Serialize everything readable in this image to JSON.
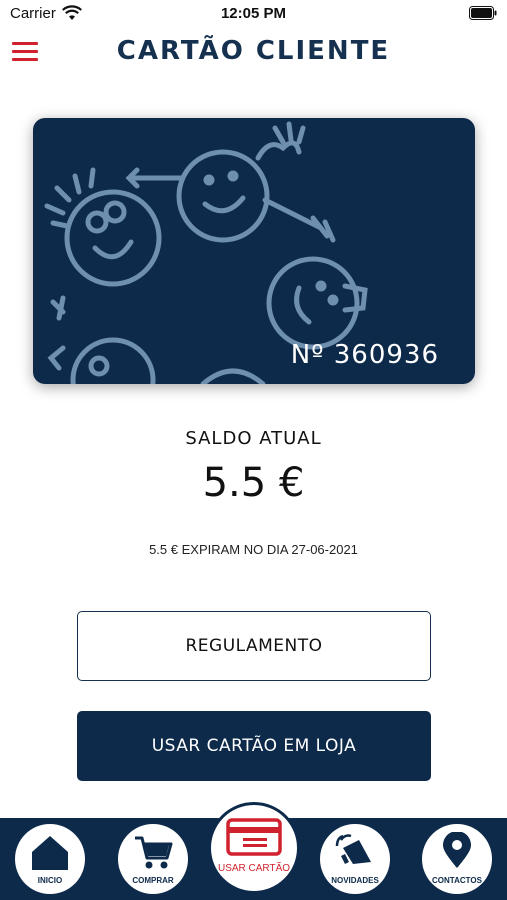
{
  "status": {
    "carrier": "Carrier",
    "time": "12:05 PM"
  },
  "header": {
    "title": "CARTÃO CLIENTE",
    "menu_icon": "hamburger-menu-icon"
  },
  "card": {
    "number": "Nº 360936",
    "background": "#0d2a4b"
  },
  "balance": {
    "label": "SALDO ATUAL",
    "value": "5.5 €",
    "expiry": "5.5 € EXPIRAM NO DIA 27-06-2021"
  },
  "buttons": {
    "rules": "REGULAMENTO",
    "use_in_store": "USAR CARTÃO EM LOJA"
  },
  "tabs": [
    {
      "label": "INICIO",
      "icon": "home-icon"
    },
    {
      "label": "COMPRAR",
      "icon": "cart-icon"
    },
    {
      "label": "USAR CARTÃO",
      "icon": "card-icon"
    },
    {
      "label": "NOVIDADES",
      "icon": "megaphone-icon"
    },
    {
      "label": "CONTACTOS",
      "icon": "location-pin-icon"
    }
  ],
  "colors": {
    "navy": "#0d2a4b",
    "accent_red": "#d0222e",
    "title": "#15314f"
  }
}
